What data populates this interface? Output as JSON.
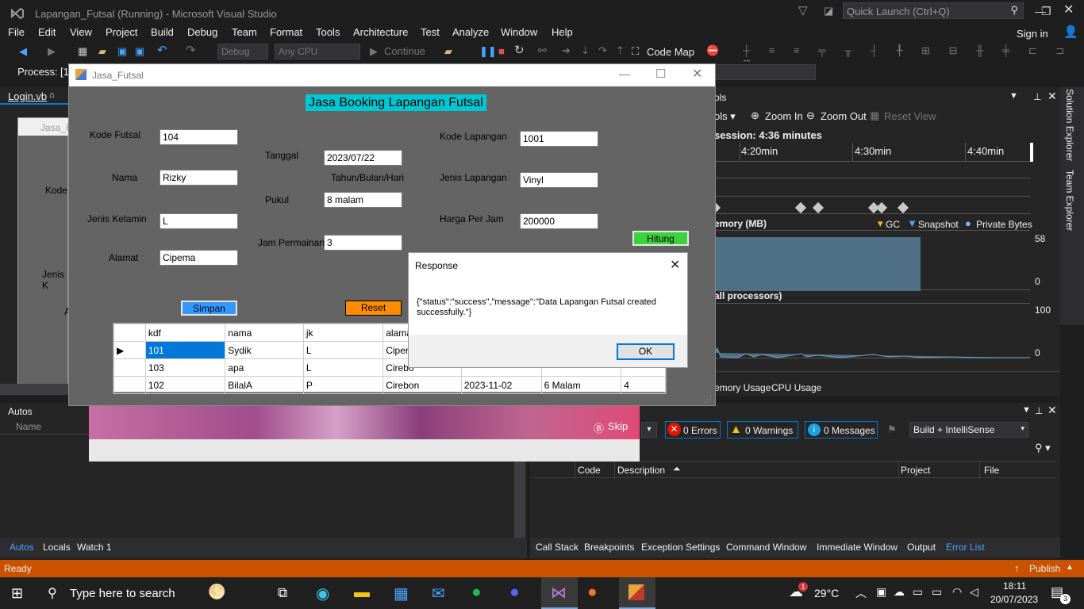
{
  "vs": {
    "window_title": "Lapangan_Futsal (Running) - Microsoft Visual Studio",
    "quick_launch": "Quick Launch (Ctrl+Q)",
    "sign_in": "Sign in",
    "menu": [
      "File",
      "Edit",
      "View",
      "Project",
      "Build",
      "Debug",
      "Team",
      "Format",
      "Tools",
      "Architecture",
      "Test",
      "Analyze",
      "Window",
      "Help"
    ],
    "toolbar": {
      "config": "Debug",
      "platform": "Any CPU",
      "continue": "Continue",
      "code_map": "Code Map",
      "process_label": "Process:",
      "process_value": "[1"
    },
    "doc_tab": "Login.vb",
    "designer_form_title": "Jasa_Fu",
    "designer_labels": [
      "Kode",
      "Jenis K",
      "A"
    ]
  },
  "diag": {
    "tools_label": "ols",
    "tools_menu": "ols",
    "zoom_in": "Zoom In",
    "zoom_out": "Zoom Out",
    "reset_view": "Reset View",
    "session": "session: 4:36 minutes",
    "timeline": [
      "4:20min",
      "4:30min",
      "4:40min"
    ],
    "memory_title": "emory (MB)",
    "legend": {
      "gc": "GC",
      "snapshot": "Snapshot",
      "private": "Private Bytes"
    },
    "mem_max": "58",
    "mem_min": "0",
    "cpu_title": "all processors)",
    "cpu_max": "100",
    "cpu_min": "0",
    "bottom_tabs": [
      "emory Usage",
      "CPU Usage"
    ],
    "side_tabs": [
      "Solution Explorer",
      "Team Explorer"
    ],
    "colors": {
      "memory_fill": "#4f6f86",
      "cpu_line": "#4f6f86"
    }
  },
  "errorlist": {
    "errors": "0 Errors",
    "warnings": "0 Warnings",
    "messages": "0 Messages",
    "build_filter": "Build + IntelliSense",
    "columns": [
      "Code",
      "Description",
      "Project",
      "File"
    ]
  },
  "autos": {
    "title": "Autos",
    "column": "Name",
    "tabs": [
      "Autos",
      "Locals",
      "Watch 1"
    ]
  },
  "debug_tabs": [
    "Call Stack",
    "Breakpoints",
    "Exception Settings",
    "Command Window",
    "Immediate Window",
    "Output",
    "Error List"
  ],
  "status_bar": {
    "text": "Ready",
    "publish": "Publish"
  },
  "overlay": {
    "skip": "Skip"
  },
  "form": {
    "title": "Jasa_Futsal",
    "heading": "Jasa Booking Lapangan Futsal",
    "kode_futsal_label": "Kode Futsal",
    "kode_futsal": "104",
    "nama_label": "Nama",
    "nama": "Rizky",
    "jk_label": "Jenis Kelamin",
    "jk": "L",
    "alamat_label": "Alamat",
    "alamat": "Cipema",
    "tanggal_label": "Tanggal",
    "tanggal": "2023/07/22",
    "tanggal_hint": "Tahun/Bulan/Hari",
    "pukul_label": "Pukul",
    "pukul": "8 malam",
    "jam_label": "Jam Permainan",
    "jam": "3",
    "kode_lapangan_label": "Kode Lapangan",
    "kode_lapangan": "1001",
    "jenis_lapangan_label": "Jenis Lapangan",
    "jenis_lapangan": "Vinyl",
    "harga_label": "Harga Per Jam",
    "harga": "200000",
    "hitung": "Hitung",
    "simpan": "Simpan",
    "reset": "Reset",
    "grid_columns": [
      "kdf",
      "nama",
      "jk",
      "alama"
    ],
    "grid_rows": [
      [
        "101",
        "Sydik",
        "L",
        "Ciperr",
        "",
        "",
        ""
      ],
      [
        "103",
        "apa",
        "L",
        "Cirebo",
        "",
        "",
        ""
      ],
      [
        "102",
        "BilalA",
        "P",
        "Cirebon",
        "2023-11-02",
        "6 Malam",
        "4"
      ]
    ],
    "colors": {
      "heading_bg": "#00c8d2",
      "hitung_bg": "#3cd23c",
      "simpan_bg": "#3399ff",
      "reset_bg": "#ff8c00"
    }
  },
  "dialog": {
    "title": "Response",
    "message": "{\"status\":\"success\",\"message\":\"Data Lapangan Futsal created successfully.\"}",
    "ok": "OK"
  },
  "taskbar": {
    "search": "Type here to search",
    "weather": "29°C",
    "time": "18:11",
    "date": "20/07/2023",
    "notif_count": "3",
    "weather_badge": "1"
  }
}
